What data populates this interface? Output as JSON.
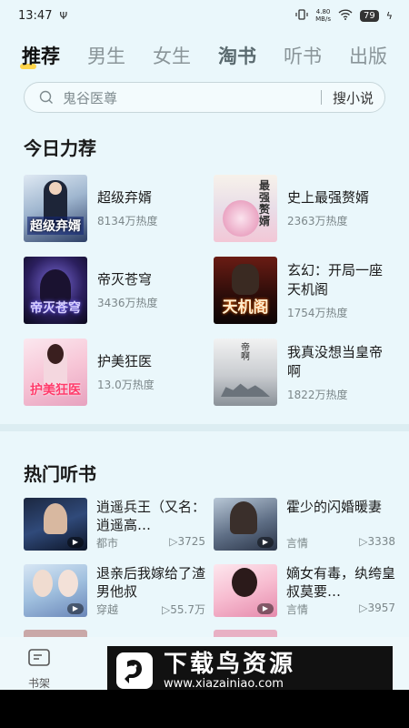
{
  "status_bar": {
    "time": "13:47",
    "usb": "Ψ",
    "net_speed": "4.80\nMB/s",
    "battery": "79"
  },
  "tabs": [
    {
      "label": "推荐"
    },
    {
      "label": "男生"
    },
    {
      "label": "女生"
    },
    {
      "label": "淘书"
    },
    {
      "label": "听书"
    },
    {
      "label": "出版"
    }
  ],
  "search": {
    "placeholder": "鬼谷医尊",
    "button": "搜小说"
  },
  "recommend": {
    "title": "今日力荐",
    "items": [
      {
        "title": "超级弃婿",
        "heat": "8134万热度",
        "cover_text": "超级弃婿"
      },
      {
        "title": "史上最强赘婿",
        "heat": "2363万热度",
        "cover_text": "最强赘婿"
      },
      {
        "title": "帝灭苍穹",
        "heat": "3436万热度",
        "cover_text": "帝灭苍穹"
      },
      {
        "title": "玄幻：开局一座天机阁",
        "heat": "1754万热度",
        "cover_text": "天机阁"
      },
      {
        "title": "护美狂医",
        "heat": "13.0万热度",
        "cover_text": "护美狂医"
      },
      {
        "title": "我真没想当皇帝啊",
        "heat": "1822万热度",
        "cover_text": ""
      }
    ]
  },
  "listen": {
    "title": "热门听书",
    "items": [
      {
        "title": "逍遥兵王（又名：逍遥高…",
        "tag": "都市",
        "plays": "▷3725"
      },
      {
        "title": "霍少的闪婚暖妻",
        "tag": "言情",
        "plays": "▷3338"
      },
      {
        "title": "退亲后我嫁给了渣男他叔",
        "tag": "穿越",
        "plays": "▷55.7万"
      },
      {
        "title": "嫡女有毒，纨绔皇叔莫要…",
        "tag": "言情",
        "plays": "▷3957"
      }
    ]
  },
  "bottom_nav": {
    "shelf": "书架"
  },
  "watermark": {
    "main": "下载鸟资源",
    "url": "www.xiazainiao.com"
  }
}
